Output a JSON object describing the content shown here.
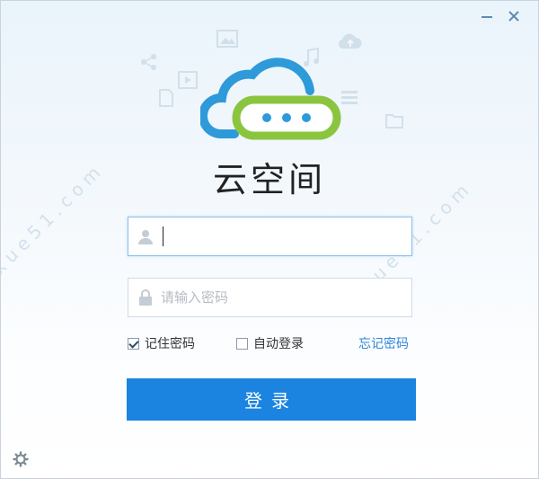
{
  "app": {
    "title": "云空间"
  },
  "username": {
    "value": "",
    "placeholder": ""
  },
  "password": {
    "value": "",
    "placeholder": "请输入密码"
  },
  "options": {
    "remember_label": "记住密码",
    "remember_checked": true,
    "auto_login_label": "自动登录",
    "auto_login_checked": false,
    "forgot_label": "忘记密码"
  },
  "login_button": {
    "label": "登录"
  },
  "colors": {
    "accent": "#1a84e0",
    "link": "#2f86d6",
    "logo_blue": "#2e9ad9",
    "logo_green": "#8bc53f"
  }
}
